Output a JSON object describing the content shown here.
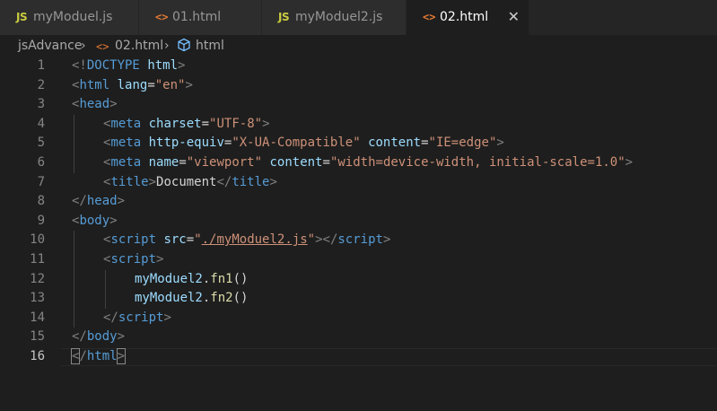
{
  "tabs": [
    {
      "icon": "JS",
      "label": "myModuel.js",
      "active": false
    },
    {
      "icon": "<>",
      "label": "01.html",
      "active": false
    },
    {
      "icon": "JS",
      "label": "myModuel2.js",
      "active": false
    },
    {
      "icon": "<>",
      "label": "02.html",
      "active": true,
      "close": "✕"
    }
  ],
  "breadcrumb": {
    "folder": "jsAdvance",
    "file": "02.html",
    "symbol": "html",
    "sep": "›",
    "file_icon": "<>"
  },
  "line_numbers": [
    "1",
    "2",
    "3",
    "4",
    "5",
    "6",
    "7",
    "8",
    "9",
    "10",
    "11",
    "12",
    "13",
    "14",
    "15",
    "16"
  ],
  "code": {
    "l1": {
      "open": "<!",
      "kw": "DOCTYPE",
      "sp": " ",
      "name": "html",
      "close": ">"
    },
    "l2": {
      "open": "<",
      "tag": "html",
      "sp": " ",
      "attr": "lang",
      "eq": "=",
      "val": "\"en\"",
      "close": ">"
    },
    "l3": {
      "open": "<",
      "tag": "head",
      "close": ">"
    },
    "l4": {
      "open": "<",
      "tag": "meta",
      "sp": " ",
      "attr": "charset",
      "eq": "=",
      "val": "\"UTF-8\"",
      "close": ">"
    },
    "l5": {
      "open": "<",
      "tag": "meta",
      "sp": " ",
      "attr1": "http-equiv",
      "eq1": "=",
      "val1": "\"X-UA-Compatible\"",
      "sp2": " ",
      "attr2": "content",
      "eq2": "=",
      "val2": "\"IE=edge\"",
      "close": ">"
    },
    "l6": {
      "open": "<",
      "tag": "meta",
      "sp": " ",
      "attr1": "name",
      "eq1": "=",
      "val1": "\"viewport\"",
      "sp2": " ",
      "attr2": "content",
      "eq2": "=",
      "val2": "\"width=device-width, initial-scale=1.0\"",
      "close": ">"
    },
    "l7": {
      "open": "<",
      "tag": "title",
      "close": ">",
      "text": "Document",
      "open2": "</",
      "tag2": "title",
      "close2": ">"
    },
    "l8": {
      "open": "</",
      "tag": "head",
      "close": ">"
    },
    "l9": {
      "open": "<",
      "tag": "body",
      "close": ">"
    },
    "l10": {
      "open": "<",
      "tag": "script",
      "sp": " ",
      "attr": "src",
      "eq": "=",
      "q1": "\"",
      "val": "./myModuel2.js",
      "q2": "\"",
      "close": ">",
      "open2": "</",
      "tag2": "script",
      "close2": ">"
    },
    "l11": {
      "open": "<",
      "tag": "script",
      "close": ">"
    },
    "l12": {
      "obj": "myModuel2",
      "dot": ".",
      "fn": "fn1",
      "paren": "()"
    },
    "l13": {
      "obj": "myModuel2",
      "dot": ".",
      "fn": "fn2",
      "paren": "()"
    },
    "l14": {
      "open": "</",
      "tag": "script",
      "close": ">"
    },
    "l15": {
      "open": "</",
      "tag": "body",
      "close": ">"
    },
    "l16": {
      "open": "<",
      "slash": "/",
      "tag": "html",
      "close": ">"
    }
  },
  "colors": {
    "editor_bg": "#1e1e1e",
    "tabbar_bg": "#252526",
    "tag": "#569cd6",
    "attr": "#9cdcfe",
    "string": "#ce9178",
    "function": "#dcdcaa",
    "js_icon": "#cbcb41",
    "html_icon": "#e37933"
  }
}
